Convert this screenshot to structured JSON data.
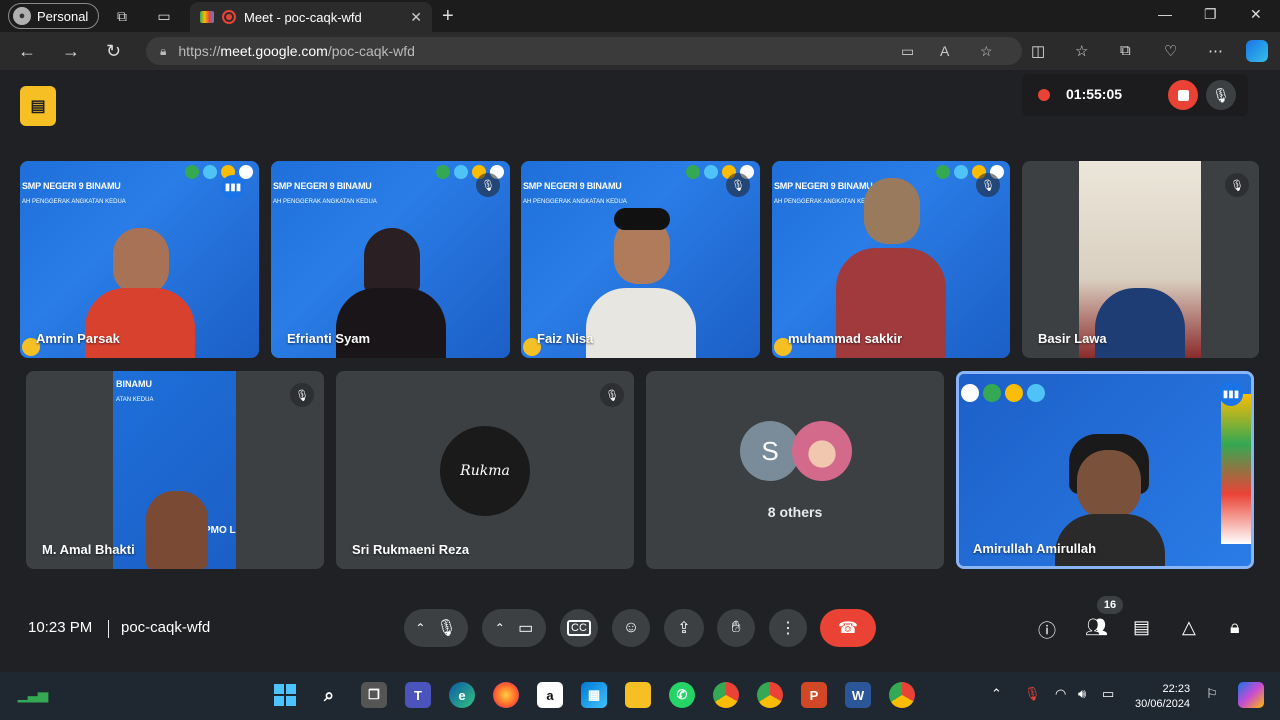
{
  "browser": {
    "profile_label": "Personal",
    "tab_title": "Meet - poc-caqk-wfd",
    "url_prefix": "https://",
    "url_host": "meet.google.com",
    "url_path": "/poc-caqk-wfd"
  },
  "meet": {
    "recording_time": "01:55:05",
    "clock": "10:23 PM",
    "meeting_code": "poc-caqk-wfd",
    "participant_count": "16",
    "banner_title": "SMP NEGERI 9 BINAMU",
    "banner_subtitle": "AH PENGGERAK ANGKATAN KEDUA",
    "tiles": [
      {
        "name": "Amrin Parsak"
      },
      {
        "name": "Efrianti Syam"
      },
      {
        "name": "Faiz Nisa"
      },
      {
        "name": "muhammad sakkir"
      },
      {
        "name": "Basir Lawa"
      },
      {
        "name": "M. Amal Bhakti"
      },
      {
        "name": "Sri Rukmaeni Reza"
      },
      {
        "name": "8 others",
        "avatar_letter": "S"
      },
      {
        "name": "Amirullah Amirullah"
      }
    ]
  },
  "taskbar": {
    "time": "22:23",
    "date": "30/06/2024"
  },
  "colors": {
    "accent_blue": "#1a73e8",
    "danger_red": "#ea4335",
    "meet_bg": "#202124",
    "yellow": "#f6c025"
  }
}
